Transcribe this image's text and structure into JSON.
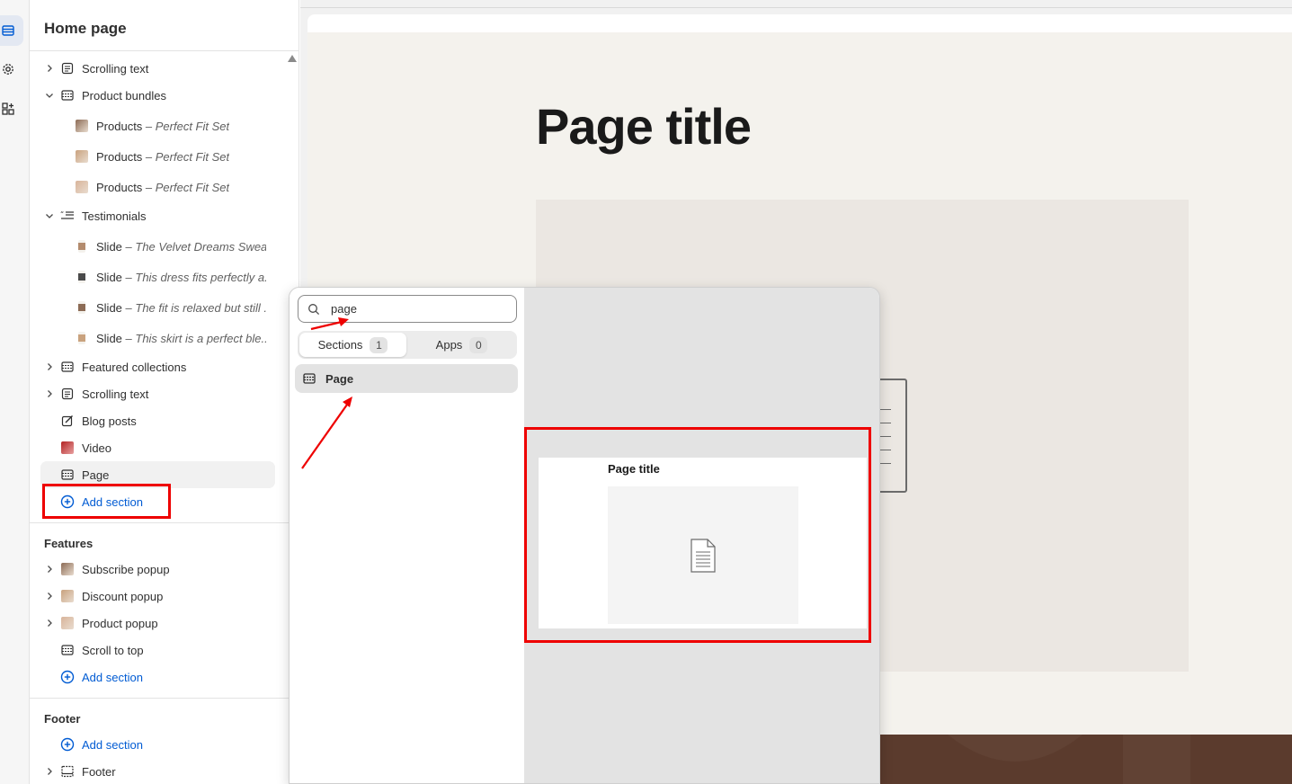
{
  "sidebar": {
    "title": "Home page",
    "template_items": [
      {
        "label": "Scrolling text",
        "detail": "",
        "icon": "text-block-icon",
        "chevron": "right"
      },
      {
        "label": "Product bundles",
        "detail": "",
        "icon": "section-icon",
        "chevron": "down"
      },
      {
        "label": "Products",
        "detail": "Perfect Fit Set",
        "icon": "product-thumbnail",
        "chevron": ""
      },
      {
        "label": "Products",
        "detail": "Perfect Fit Set",
        "icon": "product-thumbnail",
        "chevron": ""
      },
      {
        "label": "Products",
        "detail": "Perfect Fit Set",
        "icon": "product-thumbnail",
        "chevron": ""
      },
      {
        "label": "Testimonials",
        "detail": "",
        "icon": "testimonials-icon",
        "chevron": "down"
      },
      {
        "label": "Slide",
        "detail": "The Velvet Dreams Swea...",
        "icon": "slide-thumbnail",
        "chevron": ""
      },
      {
        "label": "Slide",
        "detail": "This dress fits perfectly a...",
        "icon": "slide-thumbnail",
        "chevron": ""
      },
      {
        "label": "Slide",
        "detail": "The fit is relaxed but still ...",
        "icon": "slide-thumbnail",
        "chevron": ""
      },
      {
        "label": "Slide",
        "detail": "This skirt is a perfect ble...",
        "icon": "slide-thumbnail",
        "chevron": ""
      },
      {
        "label": "Featured collections",
        "detail": "",
        "icon": "section-icon",
        "chevron": "right"
      },
      {
        "label": "Scrolling text",
        "detail": "",
        "icon": "text-block-icon",
        "chevron": "right"
      },
      {
        "label": "Blog posts",
        "detail": "",
        "icon": "blog-icon",
        "chevron": ""
      },
      {
        "label": "Video",
        "detail": "",
        "icon": "video-thumbnail",
        "chevron": ""
      },
      {
        "label": "Page",
        "detail": "",
        "icon": "section-icon",
        "chevron": ""
      }
    ],
    "add_section_label": "Add section",
    "features_heading": "Features",
    "features_items": [
      {
        "label": "Subscribe popup",
        "icon": "popup-thumbnail"
      },
      {
        "label": "Discount popup",
        "icon": "popup-thumbnail"
      },
      {
        "label": "Product popup",
        "icon": "popup-thumbnail"
      },
      {
        "label": "Scroll to top",
        "icon": "section-icon"
      }
    ],
    "footer_heading": "Footer",
    "footer_items": [
      {
        "label": "Footer",
        "icon": "footer-icon"
      }
    ]
  },
  "picker": {
    "search_value": "page",
    "tabs": [
      {
        "label": "Sections",
        "count": "1"
      },
      {
        "label": "Apps",
        "count": "0"
      }
    ],
    "result_label": "Page",
    "preview_card_title": "Page title"
  },
  "preview": {
    "page_title": "Page title"
  },
  "colors": {
    "accent": "#005bd3",
    "highlight": "#ee0000",
    "page_bg": "#f4f2ed",
    "footer_band": "#5b3b2d"
  }
}
